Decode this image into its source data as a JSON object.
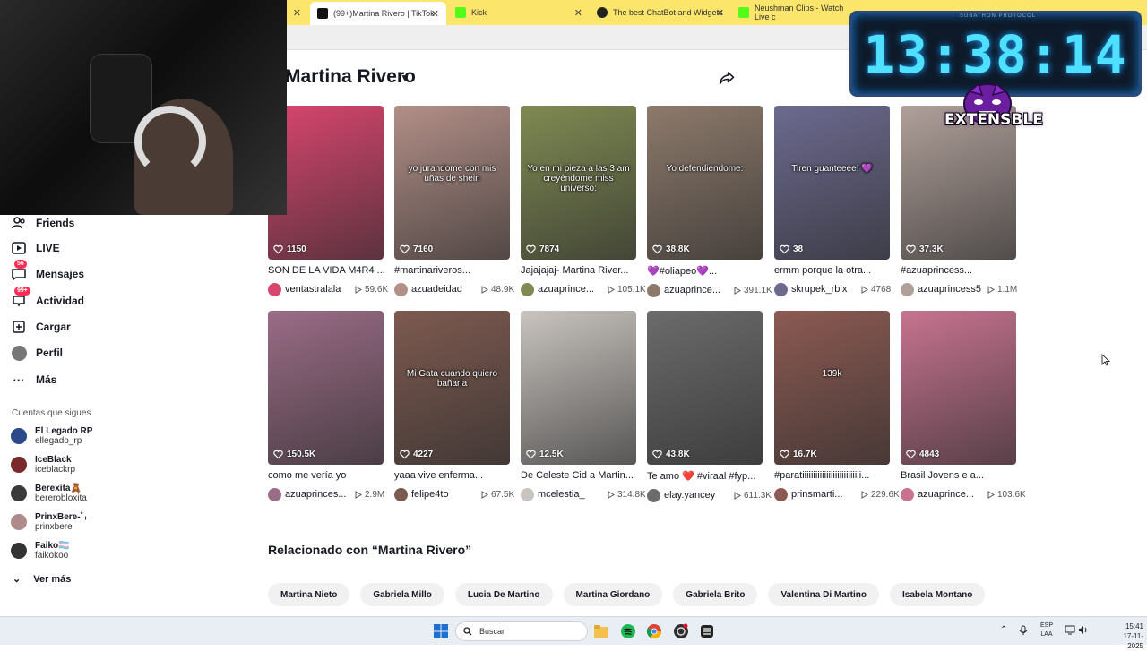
{
  "browser": {
    "tabs": [
      {
        "label": "(99+)Martina Rivero | TikTok",
        "active": true,
        "favicon": "tiktok-icon"
      },
      {
        "label": "Kick",
        "active": false,
        "favicon": "kick-icon"
      },
      {
        "label": "The best ChatBot and Widgets",
        "active": false,
        "favicon": "chatbot-icon"
      },
      {
        "label": "Neushman Clips - Watch Live c",
        "active": false,
        "favicon": "kick-icon"
      }
    ]
  },
  "profile": {
    "name": "Martina Rivero"
  },
  "videos": [
    {
      "title": "SON DE LA VIDA M4R4 ...",
      "author": "ventastralala",
      "views": "59.6K",
      "likes": "1150",
      "overlay": "",
      "color": "#d8456e"
    },
    {
      "title": "#martinariveros...",
      "author": "azuadeidad",
      "views": "48.9K",
      "likes": "7160",
      "overlay": "yo jurandome con mis uñas de shein",
      "color": "#b28f87"
    },
    {
      "title": "Jajajajaj- Martina River...",
      "author": "azuaprince...",
      "views": "105.1K",
      "likes": "7874",
      "overlay": "Yo en mi pieza a las 3 am creyéndome miss universo:",
      "color": "#7f8a52"
    },
    {
      "title": "💜#oliapeo💜...",
      "author": "azuaprince...",
      "views": "391.1K",
      "likes": "38.8K",
      "overlay": "Yo defendiendome:",
      "color": "#8d7a6b"
    },
    {
      "title": "ermm porque la otra...",
      "author": "skrupek_rblx",
      "views": "4768",
      "likes": "38",
      "overlay": "Tiren guanteeee! 💜",
      "color": "#6c6a8f"
    },
    {
      "title": "#azuaprincess...",
      "author": "azuaprincess5",
      "views": "1.1M",
      "likes": "37.3K",
      "overlay": "",
      "color": "#b0a09a"
    },
    {
      "title": "como me vería yo",
      "author": "azuaprinces...",
      "views": "2.9M",
      "likes": "150.5K",
      "overlay": "",
      "color": "#9a6c86"
    },
    {
      "title": "yaaa vive enferma...",
      "author": "felipe4to",
      "views": "67.5K",
      "likes": "4227",
      "overlay": "Mi Gata cuando quiero bañarla",
      "color": "#7d5a50"
    },
    {
      "title": "De Celeste Cid a Martin...",
      "author": "mcelestia_",
      "views": "314.8K",
      "likes": "12.5K",
      "overlay": "",
      "color": "#c9c4bf"
    },
    {
      "title": "Te amo ❤️ #viraal #fyp...",
      "author": "elay.yancey",
      "views": "611.3K",
      "likes": "43.8K",
      "overlay": "",
      "color": "#6b6b6b"
    },
    {
      "title": "#paratiiiiiiiiiiiiiiiiiiiiiiiiiii...",
      "author": "prinsmarti...",
      "views": "229.6K",
      "likes": "16.7K",
      "overlay": "139k",
      "color": "#8c5a52"
    },
    {
      "title": "Brasil Jovens e a...",
      "author": "azuaprince...",
      "views": "103.6K",
      "likes": "4843",
      "overlay": "",
      "color": "#c7738f"
    }
  ],
  "sidebar": {
    "items": [
      {
        "label": "Friends",
        "icon": "friends-icon"
      },
      {
        "label": "LIVE",
        "icon": "live-icon"
      },
      {
        "label": "Mensajes",
        "icon": "messages-icon",
        "badge": "56"
      },
      {
        "label": "Actividad",
        "icon": "activity-icon",
        "badge": "99+"
      },
      {
        "label": "Cargar",
        "icon": "upload-icon"
      },
      {
        "label": "Perfil",
        "icon": "avatar"
      },
      {
        "label": "Más",
        "icon": "more-icon"
      }
    ],
    "following_title": "Cuentas que sigues",
    "following": [
      {
        "name": "El Legado RP",
        "handle": "ellegado_rp",
        "color": "#2c4a8a"
      },
      {
        "name": "IceBlack",
        "handle": "iceblackrp",
        "color": "#7a2a2a"
      },
      {
        "name": "Berexita🧸",
        "handle": "bererobloxita",
        "color": "#3a3a3a"
      },
      {
        "name": "PrinxBere-˚₊",
        "handle": "prinxbere",
        "color": "#b08a8a"
      },
      {
        "name": "Faiko🏳️‍⚧️",
        "handle": "faikokoo",
        "color": "#333333"
      }
    ],
    "see_more": "Ver más"
  },
  "related": {
    "title": "Relacionado con “Martina Rivero”",
    "chips": [
      "Martina Nieto",
      "Gabriela Millo",
      "Lucia De Martino",
      "Martina Giordano",
      "Gabriela Brito",
      "Valentina Di Martino",
      "Isabela Montano"
    ]
  },
  "overlay": {
    "timer": "13:38:14",
    "timer_caption": "SUBATHON PROTOCOL",
    "logo_text": "EXTENSBLE"
  },
  "taskbar": {
    "search_placeholder": "Buscar",
    "lang_line1": "ESP",
    "lang_line2": "LAA",
    "time": "15:41",
    "date": "17-11-2025"
  }
}
